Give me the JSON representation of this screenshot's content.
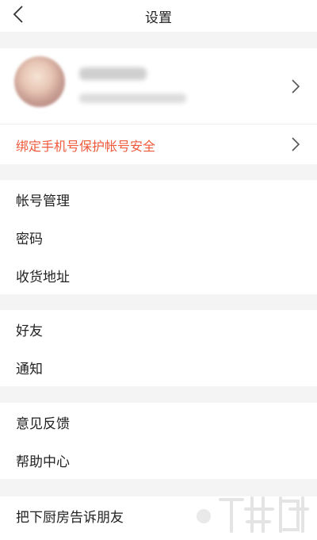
{
  "header": {
    "title": "设置"
  },
  "bind_phone": {
    "label": "绑定手机号保护帐号安全",
    "color": "#ef5a3b"
  },
  "groups": [
    {
      "items": [
        {
          "label": "帐号管理"
        },
        {
          "label": "密码"
        },
        {
          "label": "收货地址"
        }
      ]
    },
    {
      "items": [
        {
          "label": "好友"
        },
        {
          "label": "通知"
        }
      ]
    },
    {
      "items": [
        {
          "label": "意见反馈"
        },
        {
          "label": "帮助中心"
        }
      ]
    },
    {
      "items": [
        {
          "label": "把下厨房告诉朋友"
        }
      ]
    }
  ],
  "icons": {
    "back": "chevron-left-icon",
    "chevron": "chevron-right-icon"
  }
}
